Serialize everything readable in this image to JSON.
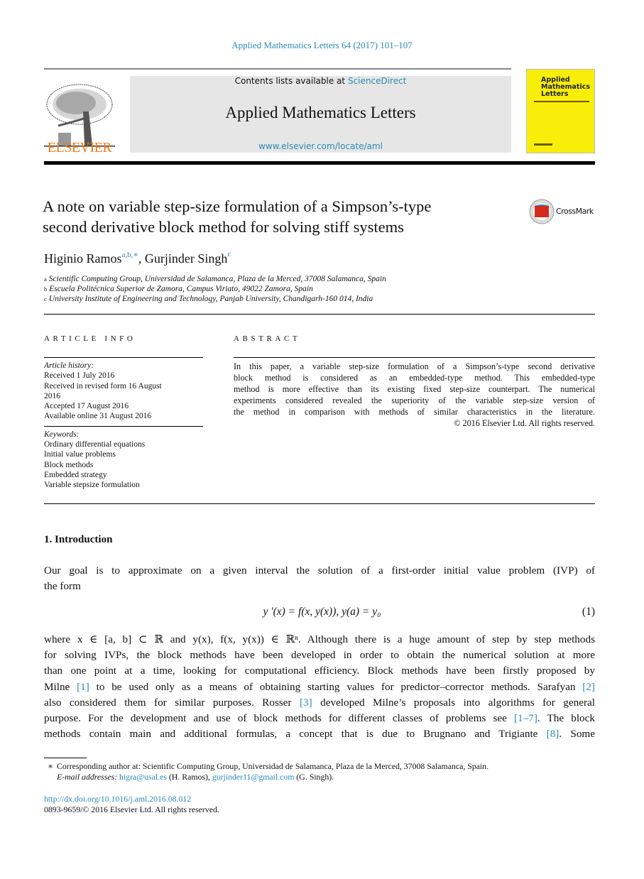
{
  "header": {
    "journal_ref": "Applied Mathematics Letters 64 (2017) 101–107",
    "contents_prefix": "Contents lists available at ",
    "contents_link": "ScienceDirect",
    "journal_title": "Applied Mathematics Letters",
    "journal_url": "www.elsevier.com/locate/aml",
    "publisher": "ELSEVIER",
    "cover_title": "Applied Mathematics Letters",
    "crossmark": "CrossMark",
    "colors": {
      "link": "#2a8ab5",
      "elsevier": "#f07c16",
      "cover": "#f9ee0a"
    }
  },
  "article": {
    "title_lines": [
      "A note on variable step-size formulation of a Simpson’s-type",
      "second derivative block method for solving stiff systems"
    ],
    "authors": [
      {
        "name": "Higinio Ramos",
        "sup": "a,b,∗"
      },
      {
        "name": "Gurjinder Singh",
        "sup": "c"
      }
    ],
    "affiliations": [
      {
        "sup": "a",
        "text": "Scientific Computing Group, Universidad de Salamanca, Plaza de la Merced, 37008 Salamanca, Spain"
      },
      {
        "sup": "b",
        "text": "Escuela Politécnica Superior de Zamora, Campus Viriato, 49022 Zamora, Spain"
      },
      {
        "sup": "c",
        "text": "University Institute of Engineering and Technology, Panjab University, Chandigarh-160 014, India"
      }
    ]
  },
  "info": {
    "heading": "ARTICLE INFO",
    "history_label": "Article history:",
    "history": [
      "Received 1 July 2016",
      "Received in revised form 16 August",
      "2016",
      "Accepted 17 August 2016",
      "Available online 31 August 2016"
    ],
    "keywords_label": "Keywords:",
    "keywords": [
      "Ordinary differential equations",
      "Initial value problems",
      "Block methods",
      "Embedded strategy",
      "Variable stepsize formulation"
    ]
  },
  "abstract": {
    "heading": "ABSTRACT",
    "lines": [
      "In this paper, a variable step-size formulation of a Simpson’s-type second derivative",
      "block method is considered as an embedded-type method. This embedded-type",
      "method is more effective than its existing fixed step-size counterpart. The numerical",
      "experiments considered revealed the superiority of the variable step-size version of",
      "the method in comparison with methods of similar characteristics in the literature."
    ],
    "copyright": "© 2016 Elsevier Ltd. All rights reserved."
  },
  "intro": {
    "heading": "1.  Introduction",
    "para1": [
      [
        "    Our goal is to approximate on a given interval the solution of a first-order initial value problem (IVP) of"
      ],
      [
        "the form"
      ]
    ],
    "equation": "y ′(x) = f(x, y(x)),    y(a) = y₀",
    "equation_number": "(1)",
    "para2": [
      [
        "where x ∈ [a, b] ⊂ ℝ and y(x), f(x, y(x)) ∈ ℝⁿ. Although there is a huge amount of step by step methods"
      ],
      [
        "for solving IVPs, the block methods have been developed in order to obtain the numerical solution at more"
      ],
      [
        "than one point at a time, looking for computational efficiency. Block methods have been firstly proposed by"
      ],
      [
        "Milne ",
        {
          "cite": "[1]"
        },
        " to be used only as a means of obtaining starting values for predictor–corrector methods. Sarafyan ",
        {
          "cite": "[2]"
        }
      ],
      [
        "also considered them for similar purposes. Rosser ",
        {
          "cite": "[3]"
        },
        " developed Milne’s proposals into algorithms for general"
      ],
      [
        "purpose. For the development and use of block methods for different classes of problems see ",
        {
          "cite": "[1–7]"
        },
        ". The block"
      ],
      [
        "methods contain main and additional formulas, a concept that is due to Brugnano and Trigiante ",
        {
          "cite": "[8]"
        },
        ". Some"
      ]
    ]
  },
  "footnotes": {
    "star": "∗",
    "corresponding": "Corresponding author at: Scientific Computing Group, Universidad de Salamanca, Plaza de la Merced, 37008 Salamanca, Spain.",
    "email_label": "E-mail addresses:",
    "email1": "higra@usal.es",
    "name1": " (H. Ramos), ",
    "email2": "gurjinder11@gmail.com",
    "name2": " (G. Singh).",
    "doi": "http://dx.doi.org/10.1016/j.aml.2016.08.012",
    "issn": "0893-9659/© 2016 Elsevier Ltd. All rights reserved."
  }
}
